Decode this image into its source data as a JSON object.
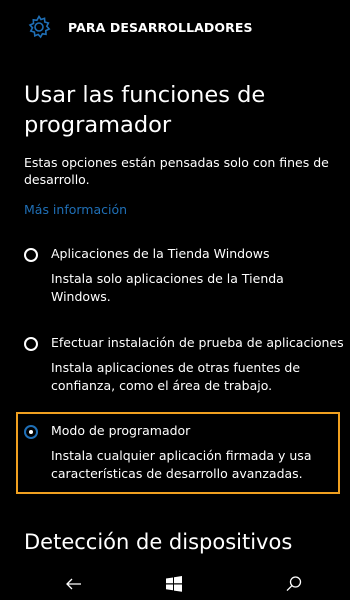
{
  "header": {
    "title": "PARA DESARROLLADORES",
    "icon": "gear-icon"
  },
  "page": {
    "title": "Usar las funciones de programador",
    "intro": "Estas opciones están pensadas solo con fines de desarrollo.",
    "link": "Más información"
  },
  "options": [
    {
      "label": "Aplicaciones de la Tienda Windows",
      "description": "Instala solo aplicaciones de la Tienda Windows.",
      "selected": false
    },
    {
      "label": "Efectuar instalación de prueba de aplicaciones",
      "description": "Instala aplicaciones de otras fuentes de confianza, como el área de trabajo.",
      "selected": false
    },
    {
      "label": "Modo de programador",
      "description": "Instala cualquier aplicación firmada y usa características de desarrollo avanzadas.",
      "selected": true
    }
  ],
  "section": {
    "title": "Detección de dispositivos"
  },
  "navbar": {
    "back_icon": "back-arrow-icon",
    "start_icon": "windows-logo-icon",
    "search_icon": "search-icon"
  },
  "colors": {
    "accent": "#1f6fb6",
    "highlight": "#f0a020",
    "background": "#000000",
    "text": "#ffffff"
  }
}
